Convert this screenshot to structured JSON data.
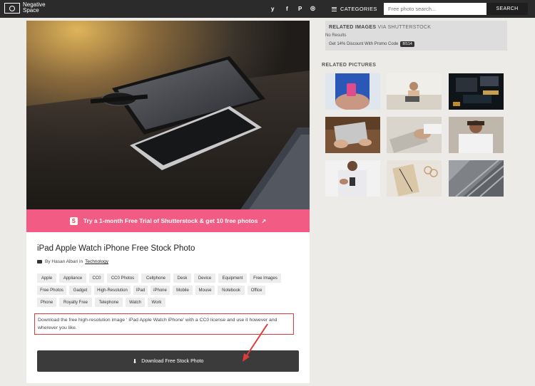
{
  "nav": {
    "logo_line1": "Negative",
    "logo_line2": "Space",
    "social": [
      "twitter-icon",
      "facebook-icon",
      "pinterest-icon",
      "instagram-icon"
    ],
    "social_glyphs": [
      "y",
      "f",
      "P",
      "◎"
    ],
    "categories_label": "CATEGORIES",
    "search_placeholder": "Free photo search...",
    "search_button": "SEARCH"
  },
  "promo": {
    "text": "Try a 1-month Free Trial of Shutterstock & get 10 free photos"
  },
  "photo": {
    "title": "iPad Apple Watch iPhone Free Stock Photo",
    "author_prefix": "By Hasan Albari in",
    "category": "Technology",
    "tags": [
      "Apple",
      "Appliance",
      "CC0",
      "CC0 Photos",
      "Cellphone",
      "Desk",
      "Device",
      "Equipment",
      "Free Images",
      "Free Photos",
      "Gadget",
      "High-Resolution",
      "IPad",
      "iPhone",
      "Mobile",
      "Mouse",
      "Notebook",
      "Office",
      "Phone",
      "Royalty Free",
      "Telephone",
      "Watch",
      "Work"
    ],
    "description": "Download the free high-resolution image ‘ iPad Apple Watch iPhone’ with a CC0 license and use it however and wherever you like.",
    "download_label": "Download Free Stock Photo"
  },
  "related_images": {
    "heading": "RELATED IMAGES",
    "via": "VIA SHUTTERSTOCK",
    "no_results": "No Results",
    "discount": "Get 14% Discount With Promo Code",
    "code": "BS14"
  },
  "related_pictures": {
    "heading": "RELATED PICTURES",
    "items": [
      {
        "name": "woman-phone-pink-case"
      },
      {
        "name": "man-laptop-bright-room"
      },
      {
        "name": "circuit-board"
      },
      {
        "name": "hands-laptop-wooden-desk"
      },
      {
        "name": "hands-typing-laptop"
      },
      {
        "name": "bearded-man-laptop"
      },
      {
        "name": "man-texting-phone"
      },
      {
        "name": "notebook-glasses"
      },
      {
        "name": "building-facade"
      }
    ]
  }
}
